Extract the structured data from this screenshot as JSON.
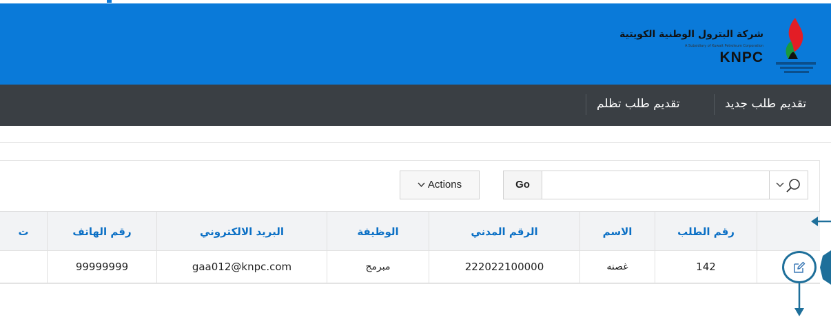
{
  "header": {
    "brand_ar": "شركة البترول الوطنية الكويتية",
    "brand_sub": "A Subsidiary of Kuwait Petroleum Corporation",
    "brand_en": "KNPC",
    "bg_color": "#0a7ad9"
  },
  "nav": {
    "items": [
      {
        "label": "تقديم طلب جديد"
      },
      {
        "label": "تقديم طلب تظلم"
      }
    ],
    "bg_color": "#3a3f44"
  },
  "toolbar": {
    "search_placeholder": "",
    "search_value": "",
    "go_label": "Go",
    "actions_label": "Actions",
    "search_icon": "search-icon",
    "actions_icon": "chevron-down-icon"
  },
  "table": {
    "columns": [
      {
        "key": "request_no",
        "label": "رقم الطلب"
      },
      {
        "key": "name",
        "label": "الاسم"
      },
      {
        "key": "civil_id",
        "label": "الرقم المدني"
      },
      {
        "key": "job",
        "label": "الوظيفة"
      },
      {
        "key": "email",
        "label": "البريد الالكتروني"
      },
      {
        "key": "phone",
        "label": "رقم الهاتف"
      },
      {
        "key": "cut",
        "label": "ت"
      }
    ],
    "rows": [
      {
        "request_no": "142",
        "name": "غصنه",
        "civil_id": "222022100000",
        "job": "مبرمج",
        "email": "gaa012@knpc.com",
        "phone": "99999999"
      }
    ],
    "header_text_color": "#0a6fc5",
    "edit_icon": "edit-icon"
  },
  "annotations": {
    "highlight_color": "#1e6f9a",
    "arrow_color": "#1e6f9a"
  }
}
